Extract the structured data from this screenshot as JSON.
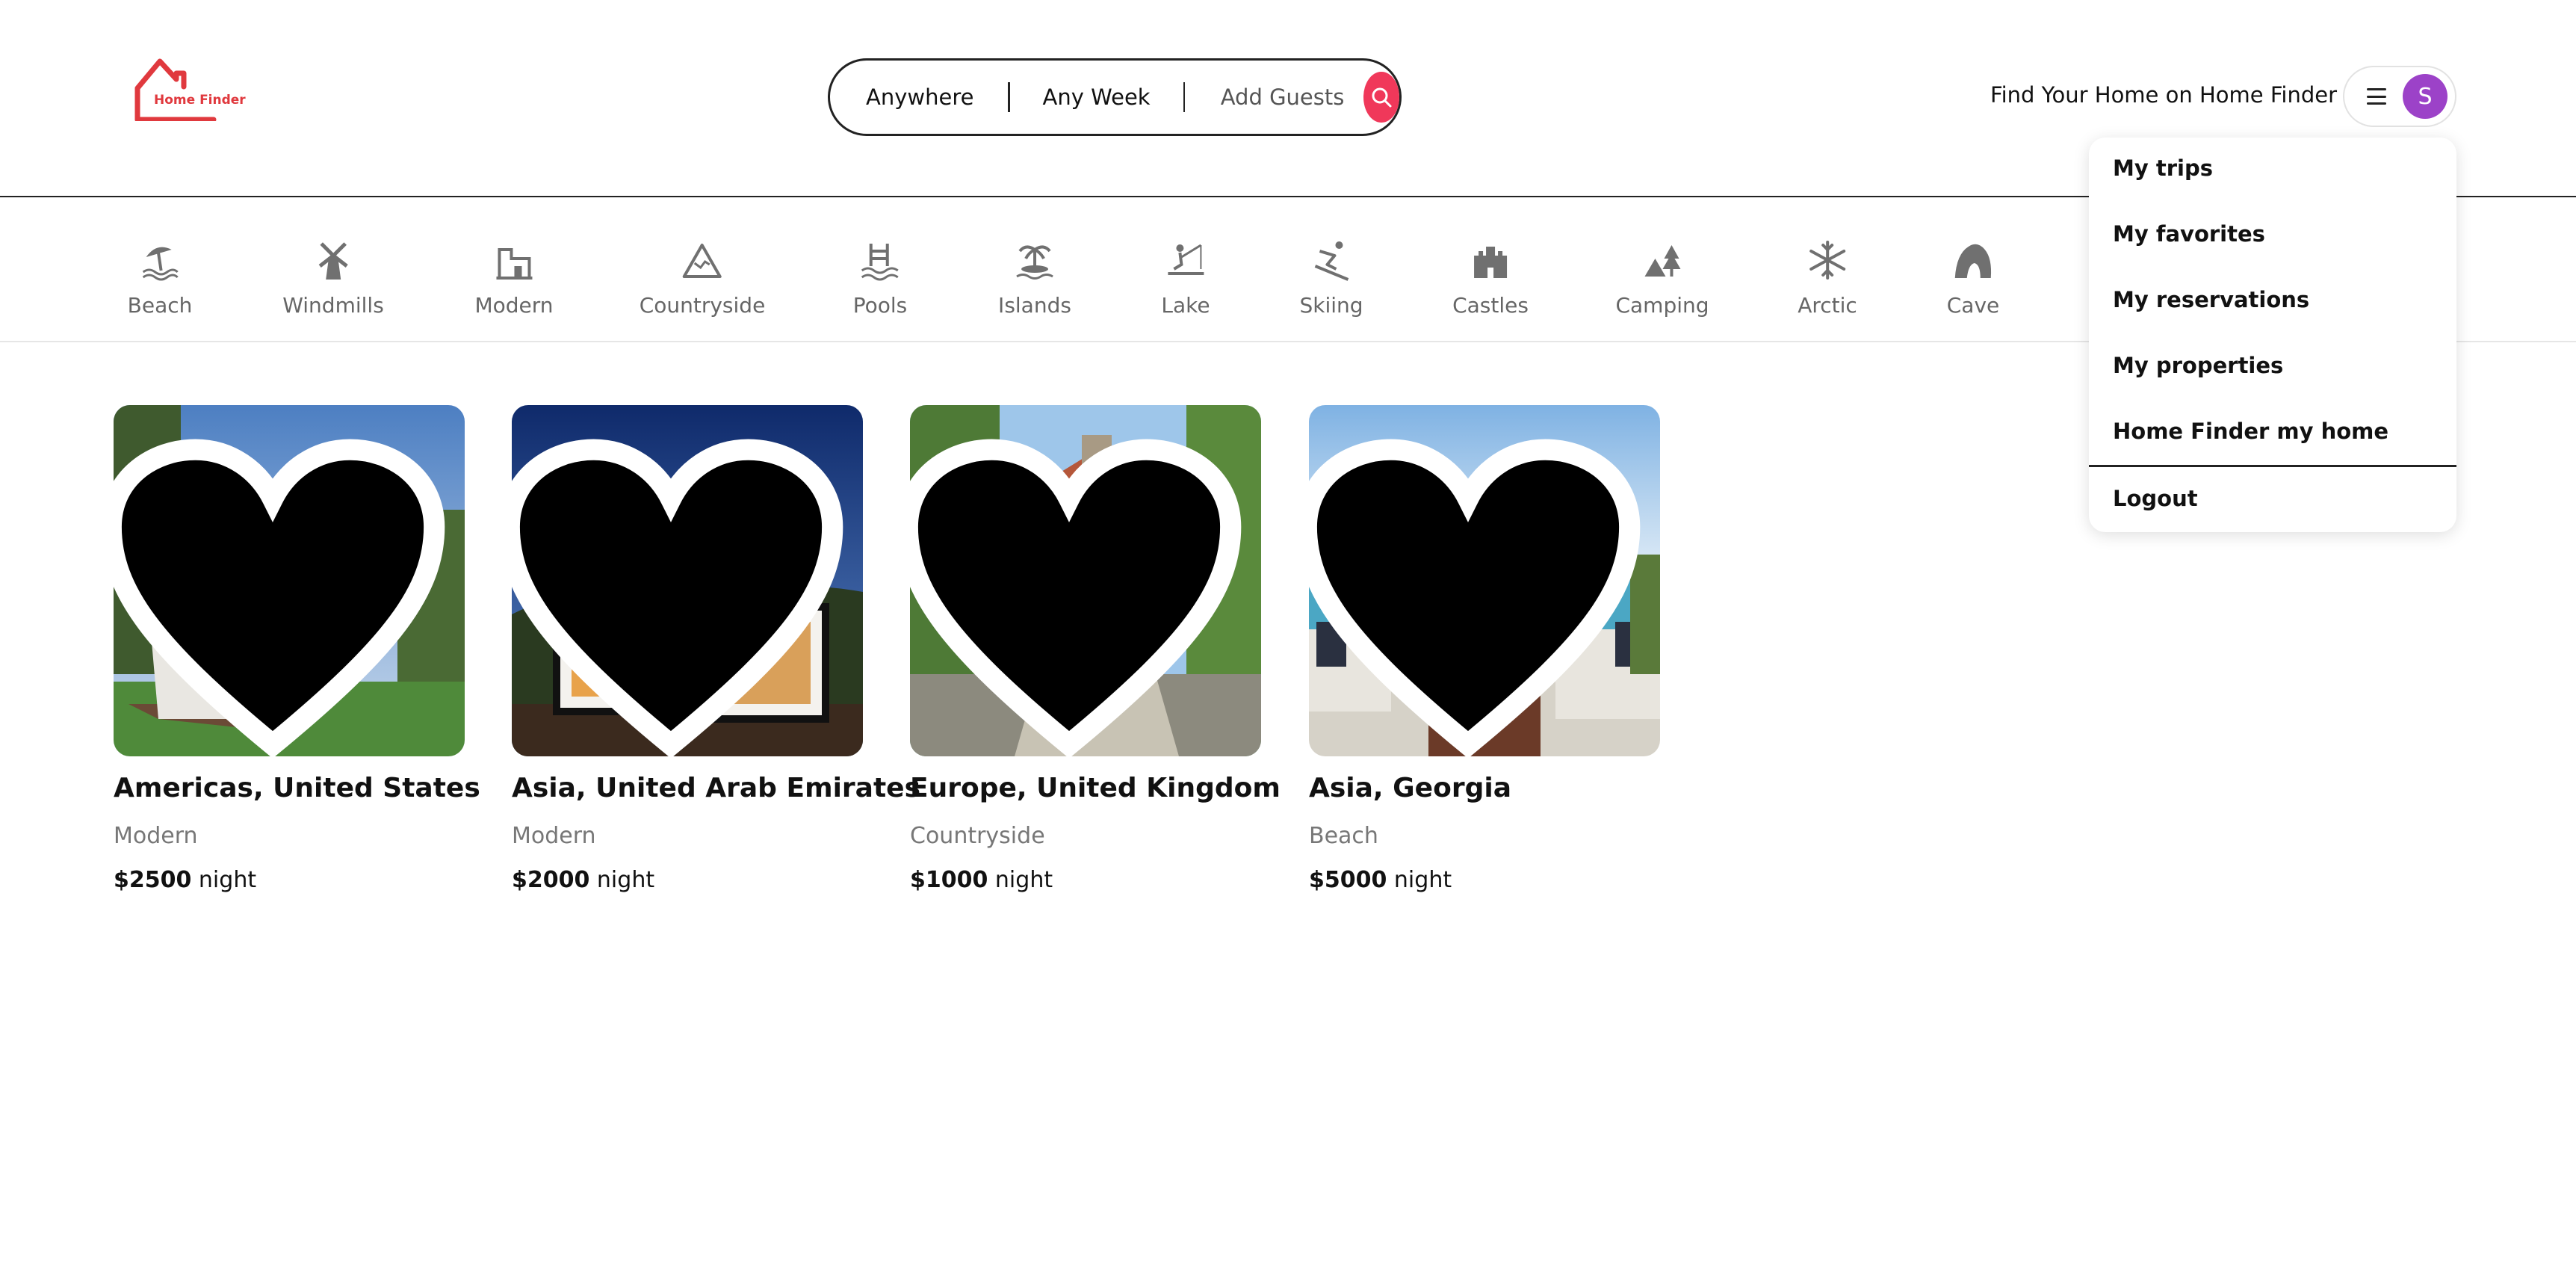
{
  "brand": {
    "name": "Home Finder",
    "color": "#e0393e"
  },
  "search": {
    "location": "Anywhere",
    "week": "Any Week",
    "guests": "Add Guests",
    "button_color": "#f0385a"
  },
  "header": {
    "cta": "Find Your Home on Home Finder",
    "avatar_initial": "S",
    "avatar_color": "#9c42c8"
  },
  "categories": [
    {
      "label": "Beach",
      "icon": "beach-umbrella-icon"
    },
    {
      "label": "Windmills",
      "icon": "windmill-icon"
    },
    {
      "label": "Modern",
      "icon": "modern-house-icon"
    },
    {
      "label": "Countryside",
      "icon": "mountain-icon"
    },
    {
      "label": "Pools",
      "icon": "pool-icon"
    },
    {
      "label": "Islands",
      "icon": "island-icon"
    },
    {
      "label": "Lake",
      "icon": "lake-icon"
    },
    {
      "label": "Skiing",
      "icon": "skiing-icon"
    },
    {
      "label": "Castles",
      "icon": "castle-icon"
    },
    {
      "label": "Camping",
      "icon": "camping-icon"
    },
    {
      "label": "Arctic",
      "icon": "snowflake-icon"
    },
    {
      "label": "Cave",
      "icon": "cave-icon"
    }
  ],
  "listings": [
    {
      "location": "Americas, United States",
      "type": "Modern",
      "price": "$2500",
      "unit": "night"
    },
    {
      "location": "Asia, United Arab Emirates",
      "type": "Modern",
      "price": "$2000",
      "unit": "night"
    },
    {
      "location": "Europe, United Kingdom",
      "type": "Countryside",
      "price": "$1000",
      "unit": "night"
    },
    {
      "location": "Asia, Georgia",
      "type": "Beach",
      "price": "$5000",
      "unit": "night"
    }
  ],
  "menu": {
    "items": [
      "My trips",
      "My favorites",
      "My reservations",
      "My properties",
      "Home Finder my home"
    ],
    "logout": "Logout"
  }
}
